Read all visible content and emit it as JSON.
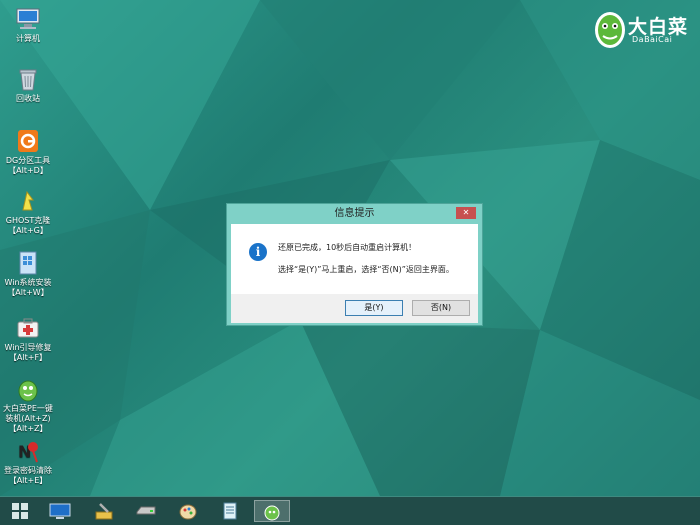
{
  "desktop": {
    "icons": [
      {
        "name": "computer-icon",
        "label1": "计算机",
        "label2": ""
      },
      {
        "name": "recycle-bin-icon",
        "label1": "回收站",
        "label2": ""
      },
      {
        "name": "diskgenius-icon",
        "label1": "DG分区工具",
        "label2": "【Alt+D】"
      },
      {
        "name": "ghost-icon",
        "label1": "GHOST克隆",
        "label2": "【Alt+G】"
      },
      {
        "name": "win-install-icon",
        "label1": "Win系统安装",
        "label2": "【Alt+W】"
      },
      {
        "name": "boot-repair-icon",
        "label1": "Win引导修复",
        "label2": "【Alt+F】"
      },
      {
        "name": "dabaicai-install-icon",
        "label1": "大白菜PE一键",
        "label2": "装机(Alt+Z)"
      },
      {
        "name": "password-clear-icon",
        "label1": "登录密码清除",
        "label2": "【Alt+E】"
      }
    ],
    "extra_label": "【Alt+Z】"
  },
  "logo": {
    "brand": "大白菜",
    "sub": "DaBaiCai"
  },
  "dialog": {
    "title": "信息提示",
    "close": "✕",
    "icon": "i",
    "line1": "还原已完成，10秒后自动重启计算机！",
    "line2": "选择“是(Y)”马上重启，选择“否(N)”返回主界面。",
    "yes_label": "是(Y)",
    "no_label": "否(N)"
  },
  "taskbar": {
    "items": [
      "start-icon",
      "screen-icon",
      "tools-icon",
      "drive-icon",
      "paint-icon",
      "notepad-icon",
      "dabaicai-icon"
    ],
    "active": "dabaicai-icon"
  },
  "colors": {
    "accent": "#2f9d8e",
    "dialog_frame": "#7fd1c7",
    "info_blue": "#1a73c9"
  }
}
